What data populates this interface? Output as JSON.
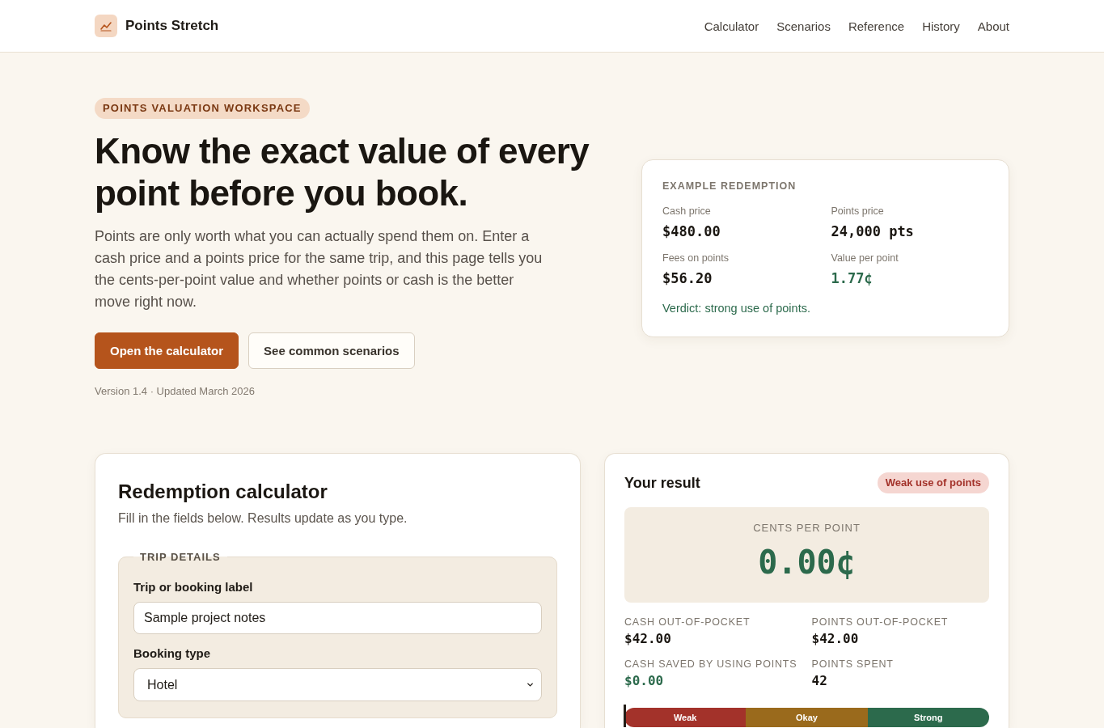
{
  "header": {
    "brand": "Points Stretch",
    "nav": [
      "Calculator",
      "Scenarios",
      "Reference",
      "History",
      "About"
    ]
  },
  "hero": {
    "eyebrow": "POINTS VALUATION WORKSPACE",
    "title": "Know the exact value of every point before you book.",
    "intro": "Points are only worth what you can actually spend them on. Enter a cash price and a points price for the same trip, and this page tells you the cents-per-point value and whether points or cash is the better move right now.",
    "buttons": [
      {
        "label": "Open the calculator",
        "kind": "primary"
      },
      {
        "label": "See common scenarios",
        "kind": "secondary"
      }
    ],
    "meta": "Version 1.4 · Updated March 2026"
  },
  "example": {
    "heading": "EXAMPLE REDEMPTION",
    "stats": [
      {
        "label": "Cash price",
        "value": "$480.00",
        "positive": false
      },
      {
        "label": "Points price",
        "value": "24,000 pts",
        "positive": false
      },
      {
        "label": "Fees on points",
        "value": "$56.20",
        "positive": false
      },
      {
        "label": "Value per point",
        "value": "1.77¢",
        "positive": true
      }
    ],
    "verdict": {
      "text": "Verdict: strong use of points.",
      "kind": "strong"
    }
  },
  "calculator": {
    "title": "Redemption calculator",
    "subtitle": "Fill in the fields below. Results update as you type.",
    "fieldset": {
      "legend": "TRIP DETAILS",
      "fields": [
        {
          "kind": "text",
          "label": "Trip or booking label",
          "value": "Sample project notes"
        },
        {
          "kind": "select",
          "label": "Booking type",
          "value": "Hotel"
        }
      ]
    }
  },
  "result": {
    "title": "Your result",
    "badge": {
      "label": "Weak use of points",
      "kind": "weak"
    },
    "cpp_label": "CENTS PER POINT",
    "cpp_value": "0.00¢",
    "stats": [
      {
        "label": "CASH OUT-OF-POCKET",
        "value": "$42.00",
        "positive": false
      },
      {
        "label": "POINTS OUT-OF-POCKET",
        "value": "$42.00",
        "positive": false
      },
      {
        "label": "CASH SAVED BY USING POINTS",
        "value": "$0.00",
        "positive": true
      },
      {
        "label": "POINTS SPENT",
        "value": "42",
        "positive": false
      }
    ],
    "meter": {
      "level": 0,
      "segments": [
        {
          "label": "Weak",
          "color": "#a3322a"
        },
        {
          "label": "Okay",
          "color": "#9a6a1c"
        },
        {
          "label": "Strong",
          "color": "#2c6a4c"
        }
      ]
    }
  }
}
